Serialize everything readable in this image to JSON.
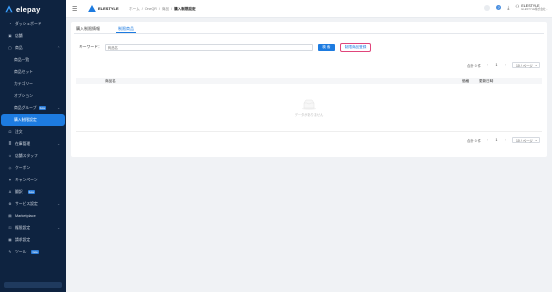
{
  "app": {
    "name": "elepay"
  },
  "sidebar": {
    "items": [
      {
        "label": "ダッシュボード",
        "icon": "gauge-icon"
      },
      {
        "label": "店舗",
        "icon": "store-icon"
      },
      {
        "label": "商品",
        "icon": "box-icon",
        "expanded": true
      },
      {
        "label": "商品一覧",
        "sub": true
      },
      {
        "label": "商品セット",
        "sub": true
      },
      {
        "label": "カテゴリー",
        "sub": true
      },
      {
        "label": "オプション",
        "sub": true
      },
      {
        "label": "商品グループ",
        "sub": true,
        "badge": "beta",
        "chevron": true
      },
      {
        "label": "購入制限設定",
        "sub": true,
        "active": true
      },
      {
        "label": "注文",
        "icon": "cart-icon"
      },
      {
        "label": "在庫管理",
        "icon": "inventory-icon",
        "chevron": true
      },
      {
        "label": "店舗スタッフ",
        "icon": "staff-icon"
      },
      {
        "label": "クーポン",
        "icon": "coupon-icon"
      },
      {
        "label": "キャンペーン",
        "icon": "campaign-icon"
      },
      {
        "label": "翻訳",
        "icon": "translate-icon",
        "badge": "beta"
      },
      {
        "label": "サービス設定",
        "icon": "service-icon",
        "chevron": true
      },
      {
        "label": "Marketplace",
        "icon": "marketplace-icon"
      },
      {
        "label": "権限設定",
        "icon": "key-icon",
        "chevron": true
      },
      {
        "label": "請求設定",
        "icon": "billing-icon"
      },
      {
        "label": "ツール",
        "icon": "tool-icon",
        "badge": "beta"
      }
    ]
  },
  "topbar": {
    "store_name": "ELESTYLE",
    "breadcrumb": [
      "ホーム",
      "OneQR",
      "商品",
      "購入制限設定"
    ],
    "user_name": "ELESTYLE",
    "user_sub": "ELESTYLE株式会社..."
  },
  "tabs": [
    {
      "label": "購入制限情報",
      "active": false
    },
    {
      "label": "制限商品",
      "active": true
    }
  ],
  "search": {
    "label": "キーワード：",
    "placeholder": "商品名",
    "button": "検 索",
    "register_button": "制限商品登録"
  },
  "pagination": {
    "total": "合計 0 件",
    "current_page": "1",
    "page_size": "10 / ページ"
  },
  "table": {
    "columns": [
      "商品名",
      "価格",
      "更新日時"
    ],
    "empty_text": "データがありません"
  },
  "colors": {
    "sidebar": "#0e2340",
    "accent": "#1d7be0",
    "highlight": "#e0457b"
  }
}
